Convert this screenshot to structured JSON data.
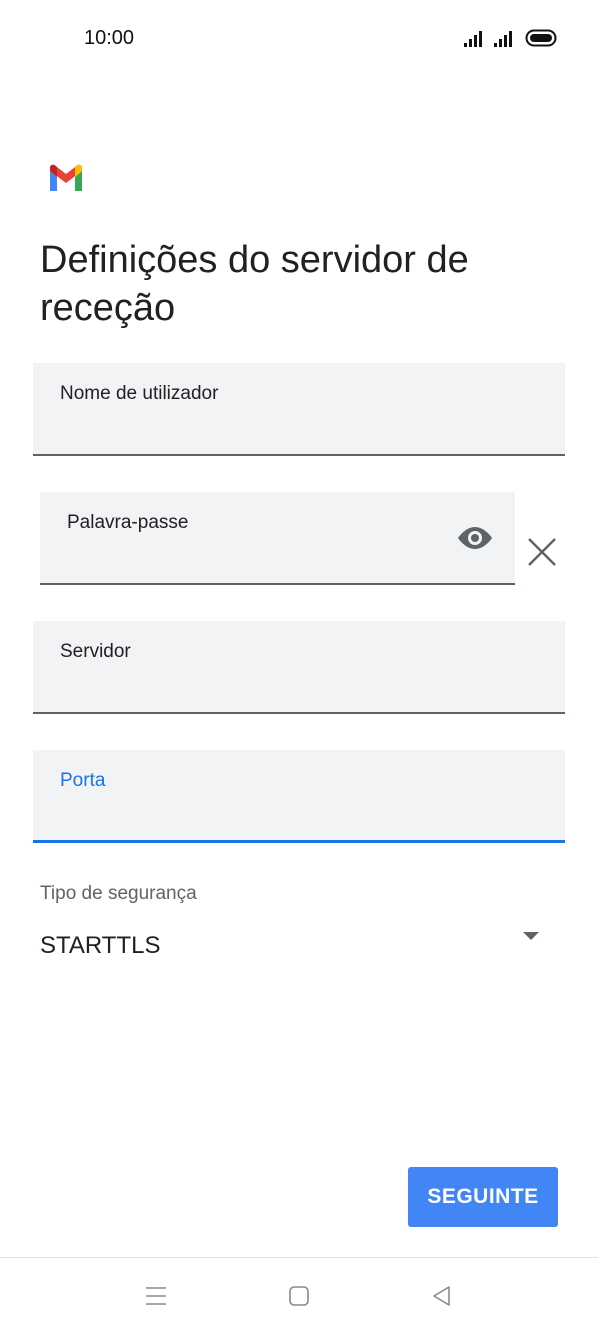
{
  "status_bar": {
    "time": "10:00",
    "icons": [
      "signal-icon",
      "signal-icon",
      "battery-icon"
    ]
  },
  "app": {
    "logo_icon": "gmail-logo",
    "colors": {
      "accent": "#1a73e8",
      "button": "#4285f4",
      "field_bg": "#f1f3f4"
    }
  },
  "page": {
    "title": "Definições do servidor de receção"
  },
  "fields": {
    "username": {
      "label": "Nome de utilizador",
      "value": ""
    },
    "password": {
      "label": "Palavra-passe",
      "value": "",
      "toggle_icon": "eye-icon",
      "clear_icon": "close-icon"
    },
    "server": {
      "label": "Servidor",
      "value": ""
    },
    "port": {
      "label": "Porta",
      "value": "",
      "focused": true
    }
  },
  "security": {
    "label": "Tipo de segurança",
    "value": "STARTTLS",
    "icon": "dropdown-arrow-icon"
  },
  "actions": {
    "next_label": "SEGUINTE"
  },
  "nav_bar": {
    "icons": [
      "menu-icon",
      "home-icon",
      "back-icon"
    ]
  }
}
